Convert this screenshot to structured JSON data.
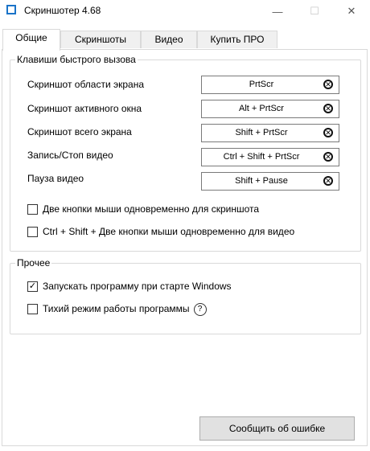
{
  "window": {
    "title": "Скриншотер 4.68",
    "min_glyph": "—",
    "max_glyph": "☐",
    "close_glyph": "✕"
  },
  "tabs": [
    {
      "label": "Общие",
      "active": true
    },
    {
      "label": "Скриншоты",
      "active": false
    },
    {
      "label": "Видео",
      "active": false
    },
    {
      "label": "Купить ПРО",
      "active": false
    }
  ],
  "hotkeys": {
    "legend": "Клавиши быстрого вызова",
    "items": [
      {
        "label": "Скриншот области экрана",
        "value": "PrtScr"
      },
      {
        "label": "Скриншот активного окна",
        "value": "Alt + PrtScr"
      },
      {
        "label": "Скриншот всего экрана",
        "value": "Shift + PrtScr"
      },
      {
        "label": "Запись/Стоп видео",
        "value": "Ctrl + Shift + PrtScr"
      },
      {
        "label": "Пауза видео",
        "value": "Shift + Pause"
      }
    ],
    "options": [
      {
        "label": "Две кнопки мыши одновременно для скриншота",
        "checked": false
      },
      {
        "label": "Ctrl + Shift + Две кнопки мыши одновременно для видео",
        "checked": false
      }
    ]
  },
  "other": {
    "legend": "Прочее",
    "options": [
      {
        "label": "Запускать программу при старте Windows",
        "checked": true
      },
      {
        "label": "Тихий режим работы программы",
        "checked": false
      }
    ],
    "help_glyph": "?"
  },
  "report_button": "Сообщить об ошибке",
  "colors": {
    "accent": "#1a73c8"
  }
}
